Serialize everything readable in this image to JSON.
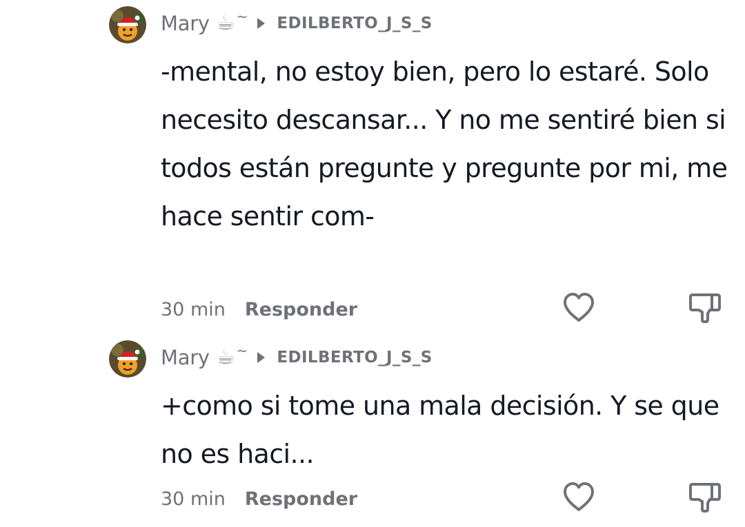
{
  "comments": [
    {
      "username": "Mary",
      "emoji": "☕",
      "tilde": "~",
      "reply_to": "EDILBERTO_J_S_S",
      "text": "-mental, no estoy bien, pero lo estaré. Solo necesito descansar... Y no me sentiré bien si todos están pregunte y pregunte por mi, me hace sentir com-",
      "time": "30 min",
      "reply_label": "Responder"
    },
    {
      "username": "Mary",
      "emoji": "☕",
      "tilde": "~",
      "reply_to": "EDILBERTO_J_S_S",
      "text": "+como si tome una mala decisión. Y se que no es haci...",
      "time": "30 min",
      "reply_label": "Responder"
    }
  ],
  "icons": {
    "like": "heart-outline-icon",
    "dislike": "thumbs-down-outline-icon",
    "reply_arrow": "play-triangle-icon",
    "avatar": "santa-hat-avatar"
  },
  "colors": {
    "text_primary": "#161823",
    "text_secondary": "#6f7178",
    "background": "#ffffff"
  }
}
